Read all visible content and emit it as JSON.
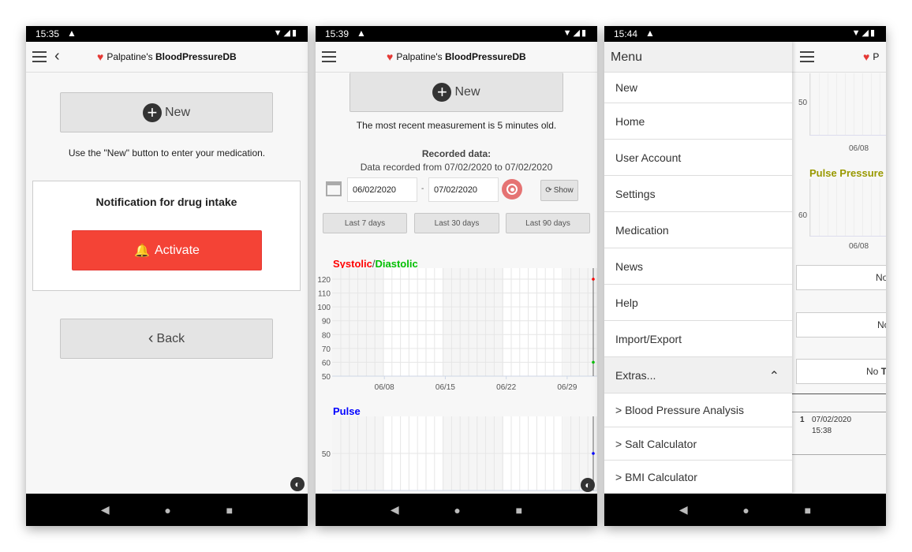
{
  "colors": {
    "accent_red": "#f44336",
    "systolic": "#ff0000",
    "diastolic": "#00c000",
    "pulse": "#0000ff",
    "pulse_pressure": "#999900"
  },
  "app_title_prefix": "Palpatine's ",
  "app_title_bold": "BloodPressureDB",
  "screen1": {
    "status_time": "15:35",
    "new_label": "New",
    "hint": "Use the \"New\" button to enter your medication.",
    "card_title": "Notification for drug intake",
    "activate_label": "Activate",
    "back_label": "Back"
  },
  "screen2": {
    "status_time": "15:39",
    "new_label": "New",
    "recent": "The most recent measurement is 5 minutes old.",
    "recorded_title": "Recorded data:",
    "recorded_range": "Data recorded from 07/02/2020 to 07/02/2020",
    "date_from": "06/02/2020",
    "date_sep": "-",
    "date_to": "07/02/2020",
    "show_label": "Show",
    "quick": [
      "Last 7 days",
      "Last 30 days",
      "Last 90 days"
    ],
    "chart1_title_a": "Systolic",
    "chart1_title_sep": "/",
    "chart1_title_b": "Diastolic",
    "chart2_title": "Pulse"
  },
  "chart_data": [
    {
      "type": "scatter",
      "title": "Systolic/Diastolic",
      "ylim": [
        50,
        128
      ],
      "yticks": [
        120,
        110,
        100,
        90,
        80,
        70,
        60,
        50
      ],
      "xticks": [
        "06/08",
        "06/15",
        "06/22",
        "06/29"
      ],
      "xrange": [
        "06/02",
        "07/02"
      ],
      "grid": true,
      "series": [
        {
          "name": "Systolic",
          "color": "#ff0000",
          "points": [
            {
              "x": "07/02",
              "y": 120
            }
          ]
        },
        {
          "name": "Diastolic",
          "color": "#00c000",
          "points": [
            {
              "x": "07/02",
              "y": 60
            }
          ]
        }
      ]
    },
    {
      "type": "scatter",
      "title": "Pulse",
      "yticks": [
        50
      ],
      "xrange": [
        "06/02",
        "07/02"
      ],
      "grid": true,
      "series": [
        {
          "name": "Pulse",
          "color": "#0000ff",
          "points": [
            {
              "x": "07/02",
              "y": 50
            }
          ]
        }
      ]
    }
  ],
  "screen3": {
    "status_time": "15:44",
    "menu_title": "Menu",
    "menu": [
      "New",
      "Home",
      "User Account",
      "Settings",
      "Medication",
      "News",
      "Help",
      "Import/Export",
      "Extras...",
      "> Blood Pressure Analysis",
      "> Salt Calculator",
      "> BMI Calculator"
    ],
    "bg_tick1": "50",
    "bg_x1": "06/08",
    "pp_title": "Pulse Pressure",
    "bg_tick2": "60",
    "bg_x2": "06/08",
    "no1": "No",
    "no2": "No",
    "no3_a": "No ",
    "no3_b": "Te",
    "row_index": "1",
    "row_date": "07/02/2020",
    "row_time": "15:38"
  }
}
